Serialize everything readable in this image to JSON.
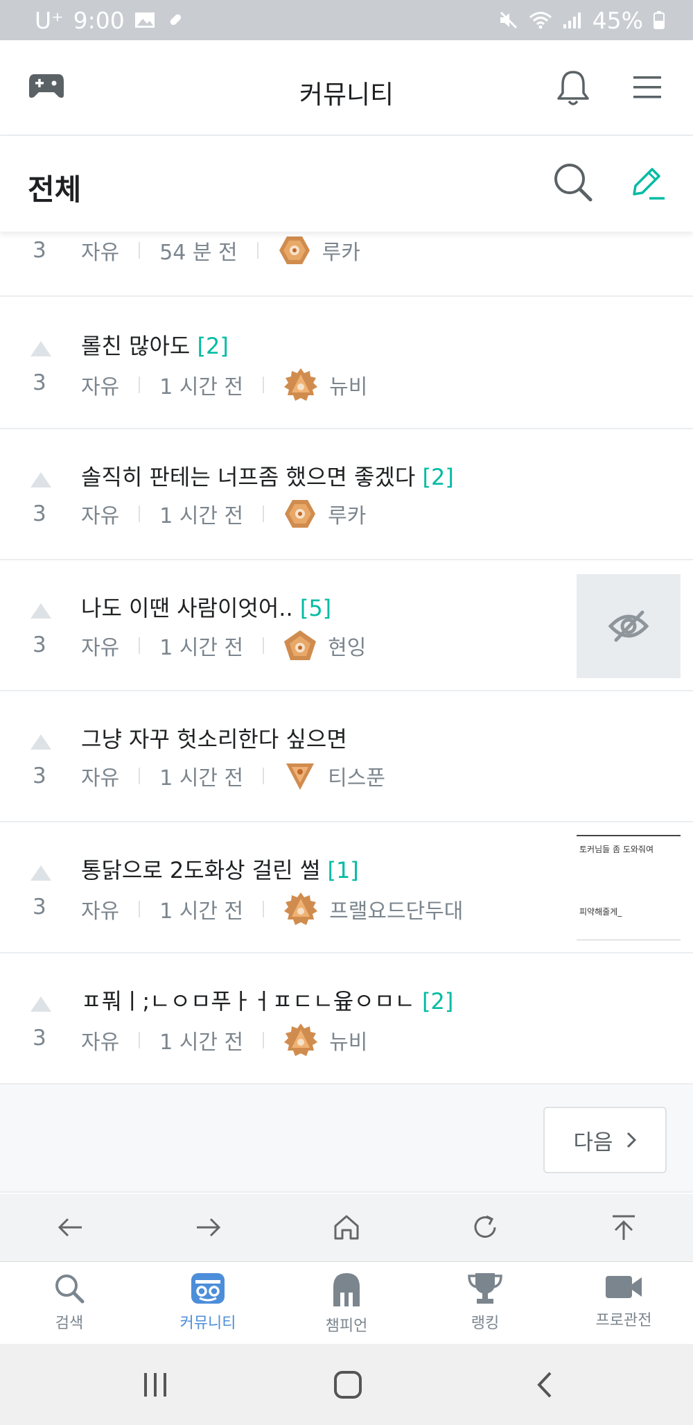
{
  "status_bar": {
    "carrier": "U⁺",
    "time": "9:00",
    "battery": "45%"
  },
  "app_bar": {
    "title": "커뮤니티"
  },
  "sub_bar": {
    "label": "전체"
  },
  "posts": [
    {
      "title": "",
      "comments": "",
      "votes": "3",
      "board": "자유",
      "time": "54 분 전",
      "author": "루카",
      "badge": "hexagon",
      "thumbnail": "none"
    },
    {
      "title": "롤친 많아도",
      "comments": "[2]",
      "votes": "3",
      "board": "자유",
      "time": "1 시간 전",
      "author": "뉴비",
      "badge": "sun",
      "thumbnail": "none"
    },
    {
      "title": "솔직히 판테는 너프좀 했으면 좋겠다",
      "comments": "[2]",
      "votes": "3",
      "board": "자유",
      "time": "1 시간 전",
      "author": "루카",
      "badge": "hexagon",
      "thumbnail": "none"
    },
    {
      "title": "나도 이땐 사람이엇어..",
      "comments": "[5]",
      "votes": "3",
      "board": "자유",
      "time": "1 시간 전",
      "author": "현잉",
      "badge": "pentagon",
      "thumbnail": "hidden"
    },
    {
      "title": "그냥 자꾸 헛소리한다 싶으면",
      "comments": "",
      "votes": "3",
      "board": "자유",
      "time": "1 시간 전",
      "author": "티스푼",
      "badge": "triangle",
      "thumbnail": "none"
    },
    {
      "title": "통닭으로 2도화상 걸린 썰",
      "comments": "[1]",
      "votes": "3",
      "board": "자유",
      "time": "1 시간 전",
      "author": "프랠요드단두대",
      "badge": "sun",
      "thumbnail": "image",
      "thumbnail_text": [
        "토커님들 좀 도와줘여",
        "피약해줄게_"
      ]
    },
    {
      "title": "ㅍ풔ㅣ;ㄴㅇㅁ푸ㅏㅓㅍㄷㄴ윺ㅇㅁㄴ",
      "comments": "[2]",
      "votes": "3",
      "board": "자유",
      "time": "1 시간 전",
      "author": "뉴비",
      "badge": "sun",
      "thumbnail": "none"
    }
  ],
  "pager": {
    "next_label": "다음"
  },
  "tabs": [
    {
      "label": "검색",
      "icon": "search-icon"
    },
    {
      "label": "커뮤니티",
      "icon": "community-icon",
      "active": true
    },
    {
      "label": "챔피언",
      "icon": "helmet-icon"
    },
    {
      "label": "랭킹",
      "icon": "trophy-icon"
    },
    {
      "label": "프로관전",
      "icon": "video-camera-icon"
    }
  ],
  "colors": {
    "accent": "#00bba3",
    "active_tab": "#4c8ed9",
    "muted": "#7b858e",
    "badge": "#d08c4e"
  }
}
